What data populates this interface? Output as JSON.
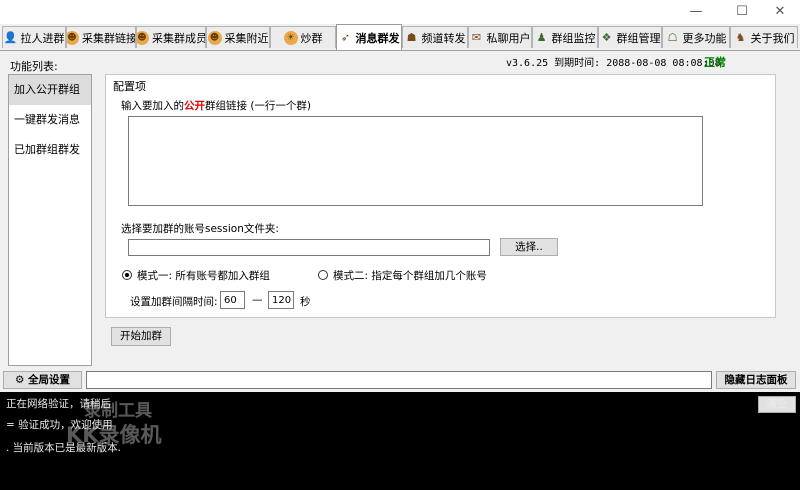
{
  "window": {
    "controls": [
      "—",
      "☐",
      "✕"
    ]
  },
  "tabs": [
    {
      "label": "拉人进群",
      "icon": "👤"
    },
    {
      "label": "采集群链接",
      "icon": "☻"
    },
    {
      "label": "采集群成员",
      "icon": "☻"
    },
    {
      "label": "采集附近",
      "icon": "☻"
    },
    {
      "label": "炒群",
      "icon": "☀"
    },
    {
      "label": "消息群发",
      "icon": "➶"
    },
    {
      "label": "频道转发",
      "icon": "☗"
    },
    {
      "label": "私聊用户",
      "icon": "✉"
    },
    {
      "label": "群组监控",
      "icon": "♟"
    },
    {
      "label": "群组管理",
      "icon": "❖"
    },
    {
      "label": "更多功能",
      "icon": "☖"
    },
    {
      "label": "关于我们",
      "icon": "♞"
    }
  ],
  "sidebar": {
    "label": "功能列表:",
    "items": [
      "加入公开群组",
      "一键群发消息",
      "已加群组群发"
    ]
  },
  "header": {
    "version_text": "v3.6.25 到期时间: 2088-08-08 08:08:08",
    "status": "正常"
  },
  "config": {
    "section_title": "配置项",
    "links_label_prefix": "输入要加入的",
    "links_label_highlight": "公开",
    "links_label_suffix": "群组链接 (一行一个群)",
    "links_value": "",
    "folder_label": "选择要加群的账号session文件夹:",
    "folder_value": "",
    "browse_button": "选择..",
    "mode1_label": "模式一: 所有账号都加入群组",
    "mode2_label": "模式二: 指定每个群组加几个账号",
    "mode_selected": "mode1",
    "interval_label": "设置加群间隔时间:",
    "interval_min": "60",
    "interval_sep": "—",
    "interval_max": "120",
    "interval_unit": "秒",
    "start_button": "开始加群"
  },
  "bottom": {
    "global_settings": "全局设置",
    "global_icon": "gear-icon",
    "hide_log": "隐藏日志面板",
    "clear": "清空"
  },
  "log": {
    "lines": [
      "正在网络验证，请稍后",
      "=     验证成功，欢迎使用",
      ". 当前版本已是最新版本."
    ]
  },
  "watermark": {
    "line1": "录制工具",
    "line2": "KK录像机"
  }
}
